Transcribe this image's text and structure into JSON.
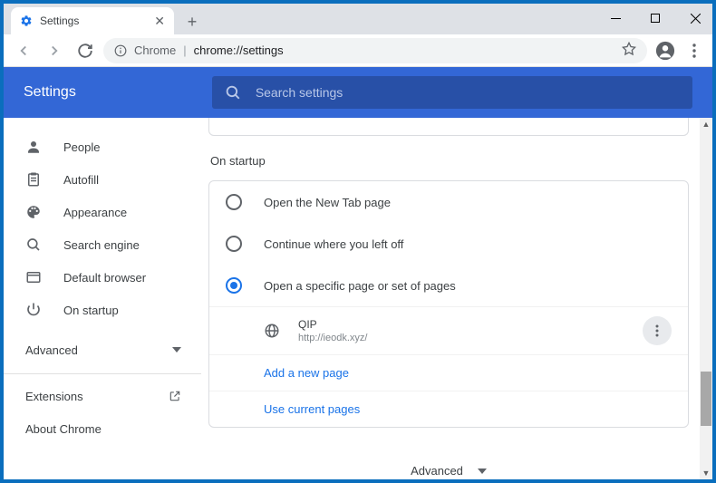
{
  "tab": {
    "title": "Settings"
  },
  "omnibox": {
    "prefix": "Chrome",
    "url": "chrome://settings"
  },
  "header": {
    "title": "Settings",
    "search_placeholder": "Search settings"
  },
  "sidebar": {
    "items": [
      {
        "label": "People"
      },
      {
        "label": "Autofill"
      },
      {
        "label": "Appearance"
      },
      {
        "label": "Search engine"
      },
      {
        "label": "Default browser"
      },
      {
        "label": "On startup"
      }
    ],
    "advanced": "Advanced",
    "extensions": "Extensions",
    "about": "About Chrome"
  },
  "content": {
    "section_title": "On startup",
    "radios": [
      {
        "label": "Open the New Tab page"
      },
      {
        "label": "Continue where you left off"
      },
      {
        "label": "Open a specific page or set of pages"
      }
    ],
    "page": {
      "name": "QIP",
      "url": "http://ieodk.xyz/"
    },
    "add_page": "Add a new page",
    "use_current": "Use current pages",
    "bottom_advanced": "Advanced"
  }
}
